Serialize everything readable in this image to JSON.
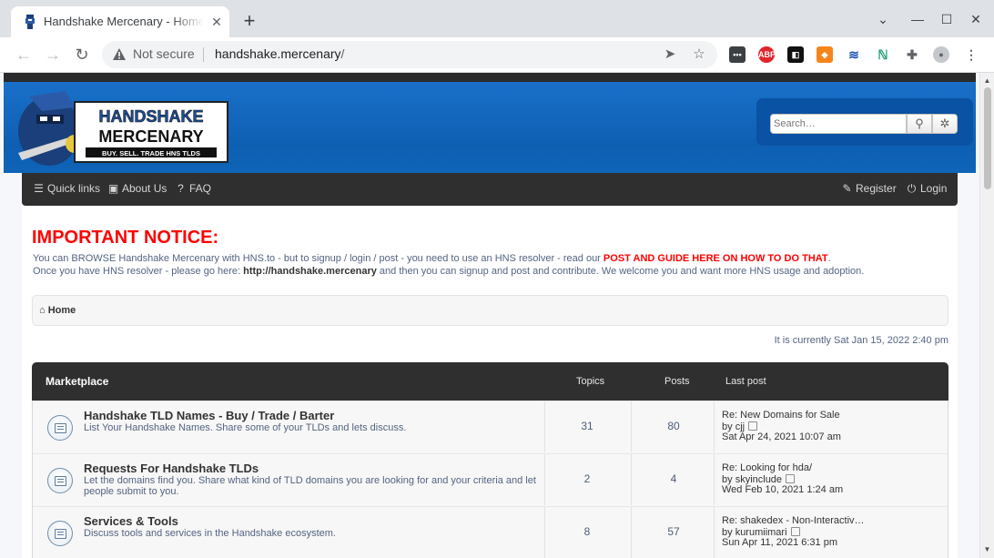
{
  "browser": {
    "tab_title": "Handshake Mercenary - Home",
    "not_secure_label": "Not secure",
    "url_host": "handshake.mercenary",
    "url_path": "/",
    "extensions": [
      "more-icon",
      "adblock-icon",
      "notion-icon",
      "metamask-icon",
      "shield-icon",
      "bookmark-icon",
      "puzzle-icon",
      "profile-icon"
    ]
  },
  "site": {
    "logo_text": "HANDSHAKE MERCENARY",
    "logo_tagline": "BUY. SELL. TRADE HNS TLDS",
    "search_placeholder": "Search…"
  },
  "navbar": {
    "quick_links": "Quick links",
    "about_us": "About Us",
    "faq": "FAQ",
    "register": "Register",
    "login": "Login"
  },
  "notice": {
    "title": "IMPORTANT NOTICE:",
    "line1_prefix": "You can BROWSE Handshake Mercenary with HNS.to - but to signup / login / post - you need to use an HNS resolver - read our",
    "line1_link": "POST AND GUIDE HERE ON HOW TO DO THAT",
    "line1_suffix": ".",
    "line2_prefix": "Once you have HNS resolver - please go here:",
    "line2_link": "http://handshake.mercenary",
    "line2_suffix": "and then you can signup and post and contribute. We welcome you and want more HNS usage and adoption."
  },
  "breadcrumb": {
    "home": "Home"
  },
  "current_time": "It is currently Sat Jan 15, 2022 2:40 pm",
  "forum": {
    "category": "Marketplace",
    "col_topics": "Topics",
    "col_posts": "Posts",
    "col_last_post": "Last post",
    "rows": [
      {
        "name": "Handshake TLD Names - Buy / Trade / Barter",
        "desc": "List Your Handshake Names. Share some of your TLDs and lets discuss.",
        "topics": "31",
        "posts": "80",
        "last_title": "Re: New Domains for Sale",
        "last_by": "by",
        "last_user": "cjj",
        "last_date": "Sat Apr 24, 2021 10:07 am"
      },
      {
        "name": "Requests For Handshake TLDs",
        "desc": "Let the domains find you. Share what kind of TLD domains you are looking for and your criteria and let people submit to you.",
        "topics": "2",
        "posts": "4",
        "last_title": "Re: Looking for hda/",
        "last_by": "by",
        "last_user": "skyinclude",
        "last_date": "Wed Feb 10, 2021 1:24 am"
      },
      {
        "name": "Services & Tools",
        "desc": "Discuss tools and services in the Handshake ecosystem.",
        "topics": "8",
        "posts": "57",
        "last_title": "Re: shakedex - Non-Interactiv…",
        "last_by": "by",
        "last_user": "kurumiimari",
        "last_date": "Sun Apr 11, 2021 6:31 pm"
      }
    ]
  }
}
